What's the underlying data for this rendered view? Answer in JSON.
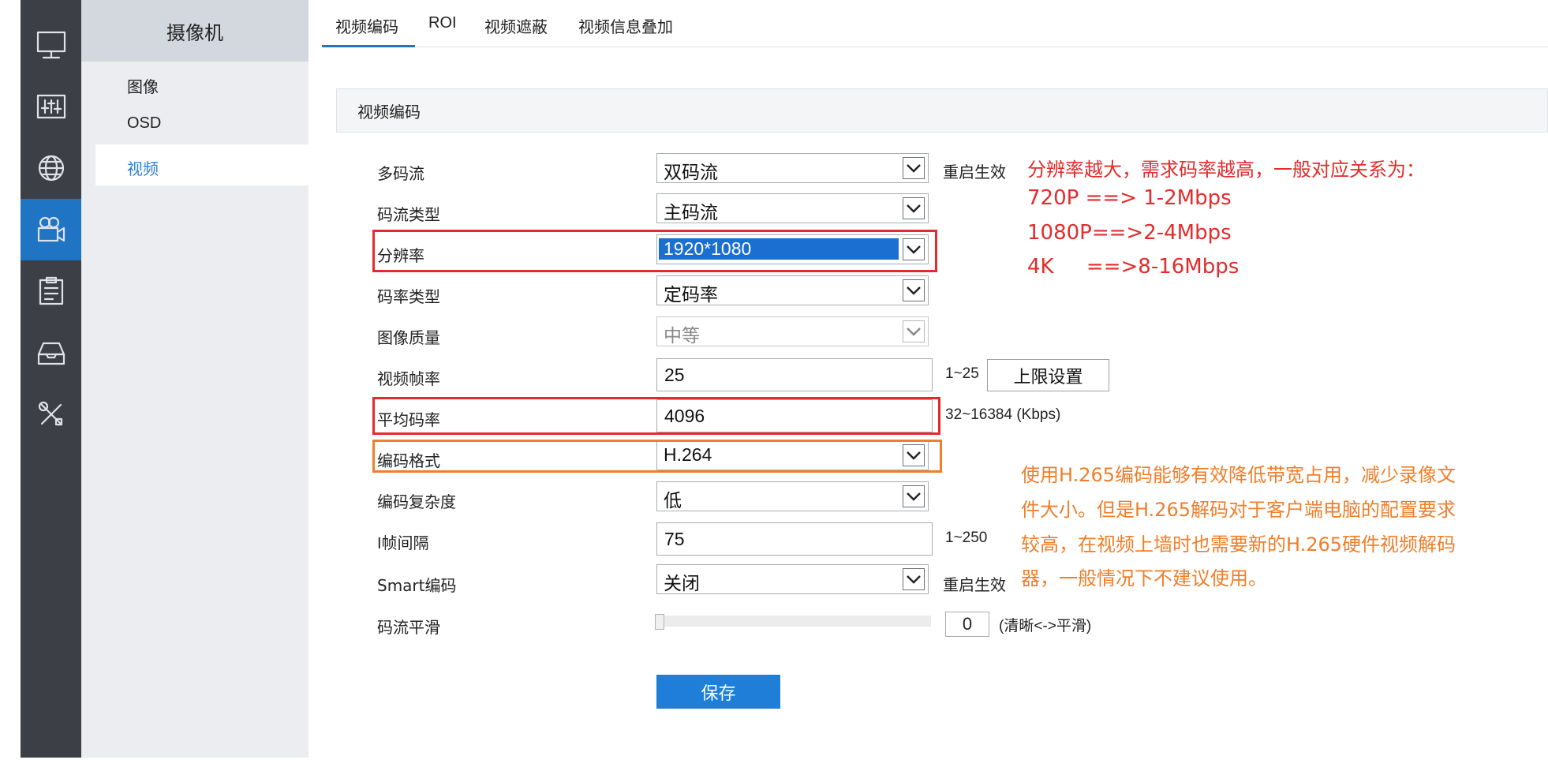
{
  "sidebar_icons": [
    {
      "name": "monitor-icon",
      "active": false
    },
    {
      "name": "sliders-icon",
      "active": false
    },
    {
      "name": "globe-icon",
      "active": false
    },
    {
      "name": "camera-icon",
      "active": true
    },
    {
      "name": "clipboard-icon",
      "active": false
    },
    {
      "name": "inbox-icon",
      "active": false
    },
    {
      "name": "tools-icon",
      "active": false
    }
  ],
  "subnav": {
    "title": "摄像机",
    "items": [
      "图像",
      "OSD",
      "视频"
    ],
    "active_index": 2
  },
  "tabs": [
    "视频编码",
    "ROI",
    "视频遮蔽",
    "视频信息叠加"
  ],
  "active_tab": 0,
  "section_title": "视频编码",
  "form": {
    "multi_stream": {
      "label": "多码流",
      "value": "双码流",
      "note": "重启生效"
    },
    "stream_type": {
      "label": "码流类型",
      "value": "主码流"
    },
    "resolution": {
      "label": "分辨率",
      "value": "1920*1080"
    },
    "bitrate_type": {
      "label": "码率类型",
      "value": "定码率"
    },
    "image_quality": {
      "label": "图像质量",
      "value": "中等",
      "disabled": true
    },
    "frame_rate": {
      "label": "视频帧率",
      "value": "25",
      "range": "1~25",
      "button": "上限设置"
    },
    "avg_bitrate": {
      "label": "平均码率",
      "value": "4096",
      "range": "32~16384 (Kbps)"
    },
    "codec": {
      "label": "编码格式",
      "value": "H.264"
    },
    "complexity": {
      "label": "编码复杂度",
      "value": "低"
    },
    "i_frame": {
      "label": "I帧间隔",
      "value": "75",
      "range": "1~250"
    },
    "smart_codec": {
      "label": "Smart编码",
      "value": "关闭",
      "note": "重启生效"
    },
    "smoothing": {
      "label": "码流平滑",
      "value": "0",
      "value_fraction": 0.0,
      "hint": "(清晰<->平滑)"
    }
  },
  "save_label": "保存",
  "annotations": {
    "resolution_note": [
      "分辨率越大，需求码率越高，一般对应关系为：",
      "720P ==> 1-2Mbps",
      "1080P==>2-4Mbps",
      "4K     ==>8-16Mbps"
    ],
    "codec_note": [
      "使用H.265编码能够有效降低带宽占用，减少录像文",
      "件大小。但是H.265解码对于客户端电脑的配置要求",
      "较高，在视频上墙时也需要新的H.265硬件视频解码",
      "器，一般情况下不建议使用。"
    ]
  },
  "colors": {
    "accent": "#1f74c4",
    "annotation_red": "#e42b2b",
    "annotation_orange": "#f07e2a"
  }
}
